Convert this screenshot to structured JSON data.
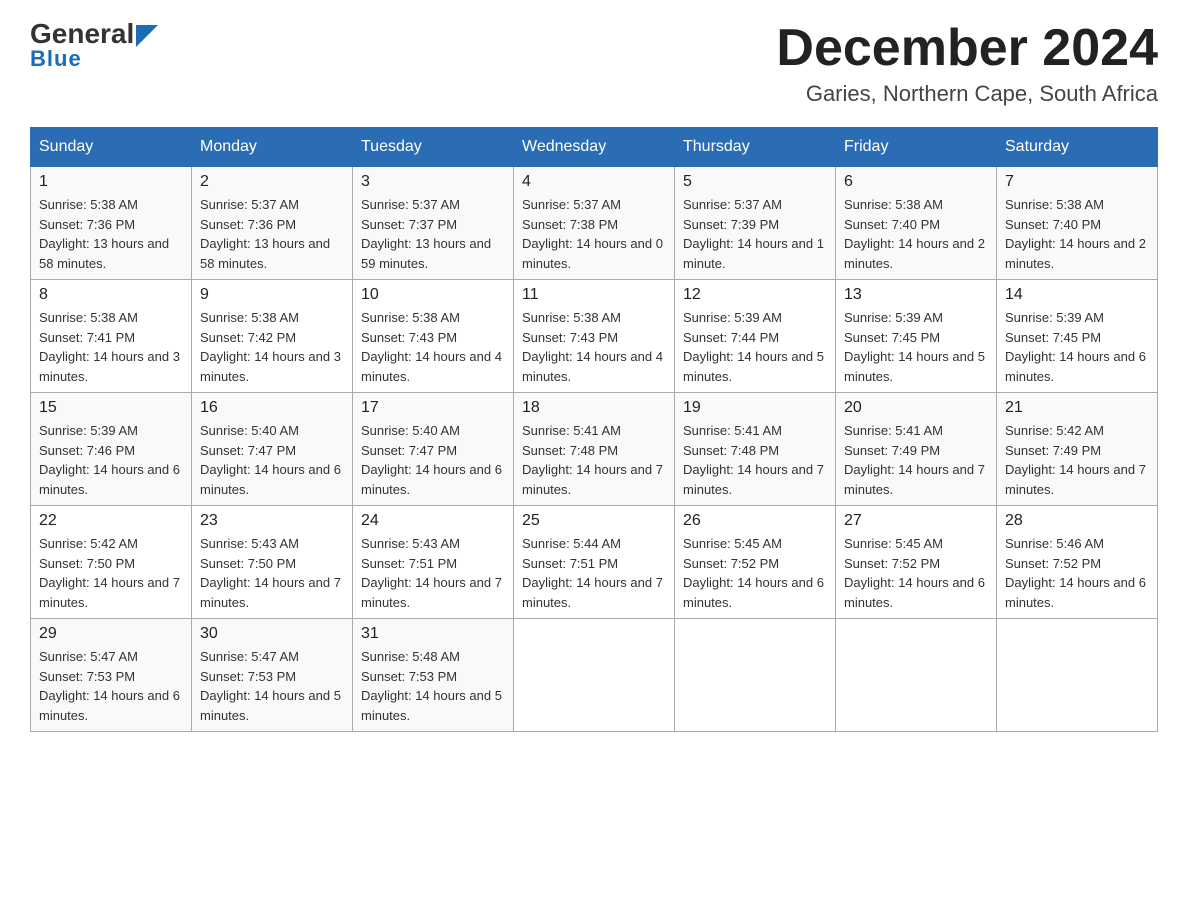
{
  "header": {
    "logo_line1": "General",
    "logo_line2": "Blue",
    "month_title": "December 2024",
    "location": "Garies, Northern Cape, South Africa"
  },
  "days_of_week": [
    "Sunday",
    "Monday",
    "Tuesday",
    "Wednesday",
    "Thursday",
    "Friday",
    "Saturday"
  ],
  "weeks": [
    [
      {
        "day": "1",
        "sunrise": "5:38 AM",
        "sunset": "7:36 PM",
        "daylight": "13 hours and 58 minutes."
      },
      {
        "day": "2",
        "sunrise": "5:37 AM",
        "sunset": "7:36 PM",
        "daylight": "13 hours and 58 minutes."
      },
      {
        "day": "3",
        "sunrise": "5:37 AM",
        "sunset": "7:37 PM",
        "daylight": "13 hours and 59 minutes."
      },
      {
        "day": "4",
        "sunrise": "5:37 AM",
        "sunset": "7:38 PM",
        "daylight": "14 hours and 0 minutes."
      },
      {
        "day": "5",
        "sunrise": "5:37 AM",
        "sunset": "7:39 PM",
        "daylight": "14 hours and 1 minute."
      },
      {
        "day": "6",
        "sunrise": "5:38 AM",
        "sunset": "7:40 PM",
        "daylight": "14 hours and 2 minutes."
      },
      {
        "day": "7",
        "sunrise": "5:38 AM",
        "sunset": "7:40 PM",
        "daylight": "14 hours and 2 minutes."
      }
    ],
    [
      {
        "day": "8",
        "sunrise": "5:38 AM",
        "sunset": "7:41 PM",
        "daylight": "14 hours and 3 minutes."
      },
      {
        "day": "9",
        "sunrise": "5:38 AM",
        "sunset": "7:42 PM",
        "daylight": "14 hours and 3 minutes."
      },
      {
        "day": "10",
        "sunrise": "5:38 AM",
        "sunset": "7:43 PM",
        "daylight": "14 hours and 4 minutes."
      },
      {
        "day": "11",
        "sunrise": "5:38 AM",
        "sunset": "7:43 PM",
        "daylight": "14 hours and 4 minutes."
      },
      {
        "day": "12",
        "sunrise": "5:39 AM",
        "sunset": "7:44 PM",
        "daylight": "14 hours and 5 minutes."
      },
      {
        "day": "13",
        "sunrise": "5:39 AM",
        "sunset": "7:45 PM",
        "daylight": "14 hours and 5 minutes."
      },
      {
        "day": "14",
        "sunrise": "5:39 AM",
        "sunset": "7:45 PM",
        "daylight": "14 hours and 6 minutes."
      }
    ],
    [
      {
        "day": "15",
        "sunrise": "5:39 AM",
        "sunset": "7:46 PM",
        "daylight": "14 hours and 6 minutes."
      },
      {
        "day": "16",
        "sunrise": "5:40 AM",
        "sunset": "7:47 PM",
        "daylight": "14 hours and 6 minutes."
      },
      {
        "day": "17",
        "sunrise": "5:40 AM",
        "sunset": "7:47 PM",
        "daylight": "14 hours and 6 minutes."
      },
      {
        "day": "18",
        "sunrise": "5:41 AM",
        "sunset": "7:48 PM",
        "daylight": "14 hours and 7 minutes."
      },
      {
        "day": "19",
        "sunrise": "5:41 AM",
        "sunset": "7:48 PM",
        "daylight": "14 hours and 7 minutes."
      },
      {
        "day": "20",
        "sunrise": "5:41 AM",
        "sunset": "7:49 PM",
        "daylight": "14 hours and 7 minutes."
      },
      {
        "day": "21",
        "sunrise": "5:42 AM",
        "sunset": "7:49 PM",
        "daylight": "14 hours and 7 minutes."
      }
    ],
    [
      {
        "day": "22",
        "sunrise": "5:42 AM",
        "sunset": "7:50 PM",
        "daylight": "14 hours and 7 minutes."
      },
      {
        "day": "23",
        "sunrise": "5:43 AM",
        "sunset": "7:50 PM",
        "daylight": "14 hours and 7 minutes."
      },
      {
        "day": "24",
        "sunrise": "5:43 AM",
        "sunset": "7:51 PM",
        "daylight": "14 hours and 7 minutes."
      },
      {
        "day": "25",
        "sunrise": "5:44 AM",
        "sunset": "7:51 PM",
        "daylight": "14 hours and 7 minutes."
      },
      {
        "day": "26",
        "sunrise": "5:45 AM",
        "sunset": "7:52 PM",
        "daylight": "14 hours and 6 minutes."
      },
      {
        "day": "27",
        "sunrise": "5:45 AM",
        "sunset": "7:52 PM",
        "daylight": "14 hours and 6 minutes."
      },
      {
        "day": "28",
        "sunrise": "5:46 AM",
        "sunset": "7:52 PM",
        "daylight": "14 hours and 6 minutes."
      }
    ],
    [
      {
        "day": "29",
        "sunrise": "5:47 AM",
        "sunset": "7:53 PM",
        "daylight": "14 hours and 6 minutes."
      },
      {
        "day": "30",
        "sunrise": "5:47 AM",
        "sunset": "7:53 PM",
        "daylight": "14 hours and 5 minutes."
      },
      {
        "day": "31",
        "sunrise": "5:48 AM",
        "sunset": "7:53 PM",
        "daylight": "14 hours and 5 minutes."
      },
      null,
      null,
      null,
      null
    ]
  ]
}
